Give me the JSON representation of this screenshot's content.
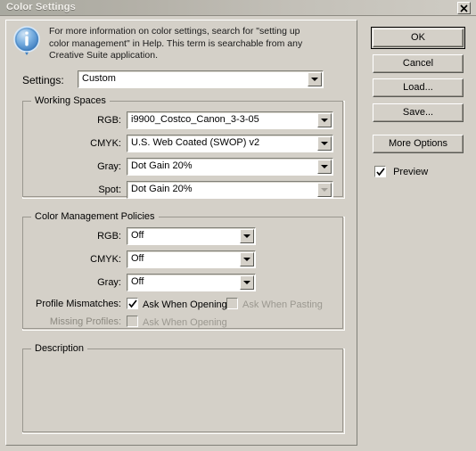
{
  "window": {
    "title": "Color Settings",
    "close_icon": "close-x-icon",
    "bg_color": "#d4d0c8",
    "titlebar_color": "#b3b0a7"
  },
  "help": {
    "icon": "info-balloon-icon",
    "text": "For more information on color settings, search for \"setting up color management\" in Help. This term is searchable from any Creative Suite application."
  },
  "settings": {
    "label": "Settings:",
    "value": "Custom",
    "arrow_icon": "chevron-down-icon"
  },
  "working_spaces": {
    "title": "Working Spaces",
    "fields": [
      {
        "label": "RGB:",
        "value": "i9900_Costco_Canon_3-3-05"
      },
      {
        "label": "CMYK:",
        "value": "U.S. Web Coated (SWOP) v2"
      },
      {
        "label": "Gray:",
        "value": "Dot Gain 20%"
      },
      {
        "label": "Spot:",
        "value": "Dot Gain 20%"
      }
    ]
  },
  "color_management_policies": {
    "title": "Color Management Policies",
    "fields": [
      {
        "label": "RGB:",
        "value": "Off"
      },
      {
        "label": "CMYK:",
        "value": "Off"
      },
      {
        "label": "Gray:",
        "value": "Off"
      }
    ],
    "profile_mismatches": {
      "label": "Profile Mismatches:",
      "ask_when_opening": {
        "label": "Ask When Opening",
        "checked": true,
        "enabled": true
      },
      "ask_when_pasting": {
        "label": "Ask When Pasting",
        "checked": false,
        "enabled": false
      }
    },
    "missing_profiles": {
      "label": "Missing Profiles:",
      "ask_when_opening": {
        "label": "Ask When Opening",
        "checked": false,
        "enabled": false
      }
    }
  },
  "description": {
    "title": "Description",
    "text": ""
  },
  "buttons": {
    "ok": "OK",
    "cancel": "Cancel",
    "load": "Load...",
    "save": "Save...",
    "more_options": "More Options"
  },
  "preview": {
    "label": "Preview",
    "checked": true
  }
}
